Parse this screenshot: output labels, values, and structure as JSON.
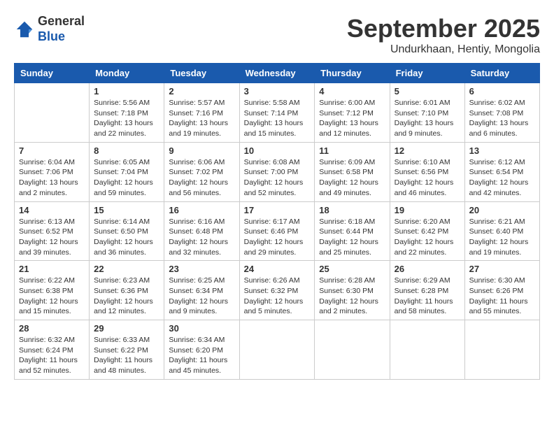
{
  "header": {
    "logo": {
      "general": "General",
      "blue": "Blue"
    },
    "title": "September 2025",
    "subtitle": "Undurkhaan, Hentiy, Mongolia"
  },
  "calendar": {
    "days_of_week": [
      "Sunday",
      "Monday",
      "Tuesday",
      "Wednesday",
      "Thursday",
      "Friday",
      "Saturday"
    ],
    "weeks": [
      [
        {
          "day": "",
          "info": ""
        },
        {
          "day": "1",
          "info": "Sunrise: 5:56 AM\nSunset: 7:18 PM\nDaylight: 13 hours\nand 22 minutes."
        },
        {
          "day": "2",
          "info": "Sunrise: 5:57 AM\nSunset: 7:16 PM\nDaylight: 13 hours\nand 19 minutes."
        },
        {
          "day": "3",
          "info": "Sunrise: 5:58 AM\nSunset: 7:14 PM\nDaylight: 13 hours\nand 15 minutes."
        },
        {
          "day": "4",
          "info": "Sunrise: 6:00 AM\nSunset: 7:12 PM\nDaylight: 13 hours\nand 12 minutes."
        },
        {
          "day": "5",
          "info": "Sunrise: 6:01 AM\nSunset: 7:10 PM\nDaylight: 13 hours\nand 9 minutes."
        },
        {
          "day": "6",
          "info": "Sunrise: 6:02 AM\nSunset: 7:08 PM\nDaylight: 13 hours\nand 6 minutes."
        }
      ],
      [
        {
          "day": "7",
          "info": "Sunrise: 6:04 AM\nSunset: 7:06 PM\nDaylight: 13 hours\nand 2 minutes."
        },
        {
          "day": "8",
          "info": "Sunrise: 6:05 AM\nSunset: 7:04 PM\nDaylight: 12 hours\nand 59 minutes."
        },
        {
          "day": "9",
          "info": "Sunrise: 6:06 AM\nSunset: 7:02 PM\nDaylight: 12 hours\nand 56 minutes."
        },
        {
          "day": "10",
          "info": "Sunrise: 6:08 AM\nSunset: 7:00 PM\nDaylight: 12 hours\nand 52 minutes."
        },
        {
          "day": "11",
          "info": "Sunrise: 6:09 AM\nSunset: 6:58 PM\nDaylight: 12 hours\nand 49 minutes."
        },
        {
          "day": "12",
          "info": "Sunrise: 6:10 AM\nSunset: 6:56 PM\nDaylight: 12 hours\nand 46 minutes."
        },
        {
          "day": "13",
          "info": "Sunrise: 6:12 AM\nSunset: 6:54 PM\nDaylight: 12 hours\nand 42 minutes."
        }
      ],
      [
        {
          "day": "14",
          "info": "Sunrise: 6:13 AM\nSunset: 6:52 PM\nDaylight: 12 hours\nand 39 minutes."
        },
        {
          "day": "15",
          "info": "Sunrise: 6:14 AM\nSunset: 6:50 PM\nDaylight: 12 hours\nand 36 minutes."
        },
        {
          "day": "16",
          "info": "Sunrise: 6:16 AM\nSunset: 6:48 PM\nDaylight: 12 hours\nand 32 minutes."
        },
        {
          "day": "17",
          "info": "Sunrise: 6:17 AM\nSunset: 6:46 PM\nDaylight: 12 hours\nand 29 minutes."
        },
        {
          "day": "18",
          "info": "Sunrise: 6:18 AM\nSunset: 6:44 PM\nDaylight: 12 hours\nand 25 minutes."
        },
        {
          "day": "19",
          "info": "Sunrise: 6:20 AM\nSunset: 6:42 PM\nDaylight: 12 hours\nand 22 minutes."
        },
        {
          "day": "20",
          "info": "Sunrise: 6:21 AM\nSunset: 6:40 PM\nDaylight: 12 hours\nand 19 minutes."
        }
      ],
      [
        {
          "day": "21",
          "info": "Sunrise: 6:22 AM\nSunset: 6:38 PM\nDaylight: 12 hours\nand 15 minutes."
        },
        {
          "day": "22",
          "info": "Sunrise: 6:23 AM\nSunset: 6:36 PM\nDaylight: 12 hours\nand 12 minutes."
        },
        {
          "day": "23",
          "info": "Sunrise: 6:25 AM\nSunset: 6:34 PM\nDaylight: 12 hours\nand 9 minutes."
        },
        {
          "day": "24",
          "info": "Sunrise: 6:26 AM\nSunset: 6:32 PM\nDaylight: 12 hours\nand 5 minutes."
        },
        {
          "day": "25",
          "info": "Sunrise: 6:28 AM\nSunset: 6:30 PM\nDaylight: 12 hours\nand 2 minutes."
        },
        {
          "day": "26",
          "info": "Sunrise: 6:29 AM\nSunset: 6:28 PM\nDaylight: 11 hours\nand 58 minutes."
        },
        {
          "day": "27",
          "info": "Sunrise: 6:30 AM\nSunset: 6:26 PM\nDaylight: 11 hours\nand 55 minutes."
        }
      ],
      [
        {
          "day": "28",
          "info": "Sunrise: 6:32 AM\nSunset: 6:24 PM\nDaylight: 11 hours\nand 52 minutes."
        },
        {
          "day": "29",
          "info": "Sunrise: 6:33 AM\nSunset: 6:22 PM\nDaylight: 11 hours\nand 48 minutes."
        },
        {
          "day": "30",
          "info": "Sunrise: 6:34 AM\nSunset: 6:20 PM\nDaylight: 11 hours\nand 45 minutes."
        },
        {
          "day": "",
          "info": ""
        },
        {
          "day": "",
          "info": ""
        },
        {
          "day": "",
          "info": ""
        },
        {
          "day": "",
          "info": ""
        }
      ]
    ]
  }
}
